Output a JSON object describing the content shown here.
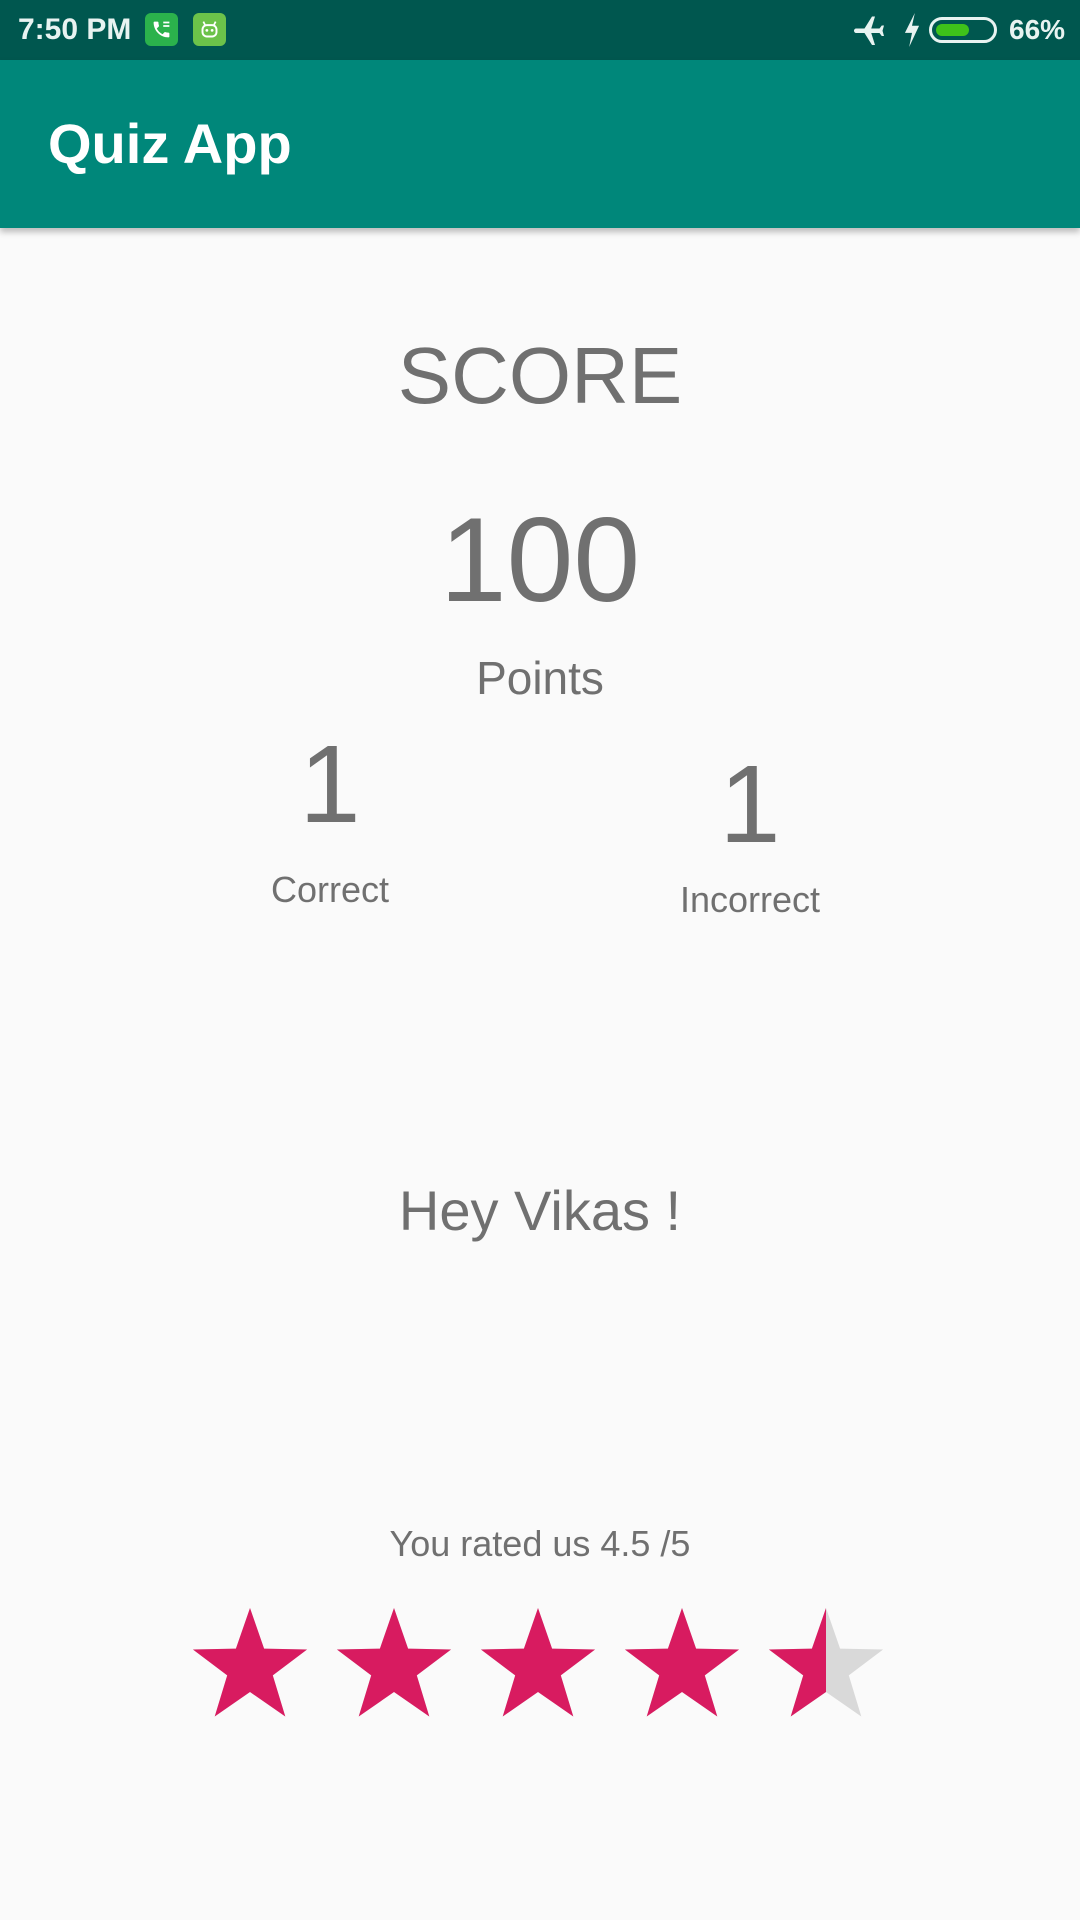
{
  "status_bar": {
    "time": "7:50 PM",
    "battery_percent": "66%",
    "battery_level": 0.66,
    "icons": [
      "phone-notification-icon",
      "bot-notification-icon",
      "airplane-mode-icon",
      "charging-icon",
      "battery-icon"
    ]
  },
  "app_bar": {
    "title": "Quiz App",
    "color": "#00877a"
  },
  "score": {
    "title": "SCORE",
    "value": "100",
    "unit": "Points"
  },
  "results": {
    "correct_value": "1",
    "correct_label": "Correct",
    "incorrect_value": "1",
    "incorrect_label": "Incorrect"
  },
  "greeting": "Hey Vikas !",
  "rating": {
    "text": "You rated us 4.5 /5",
    "value": 4.5,
    "max": 5,
    "star_color": "#d81b60",
    "empty_color": "#d9d9d9"
  }
}
